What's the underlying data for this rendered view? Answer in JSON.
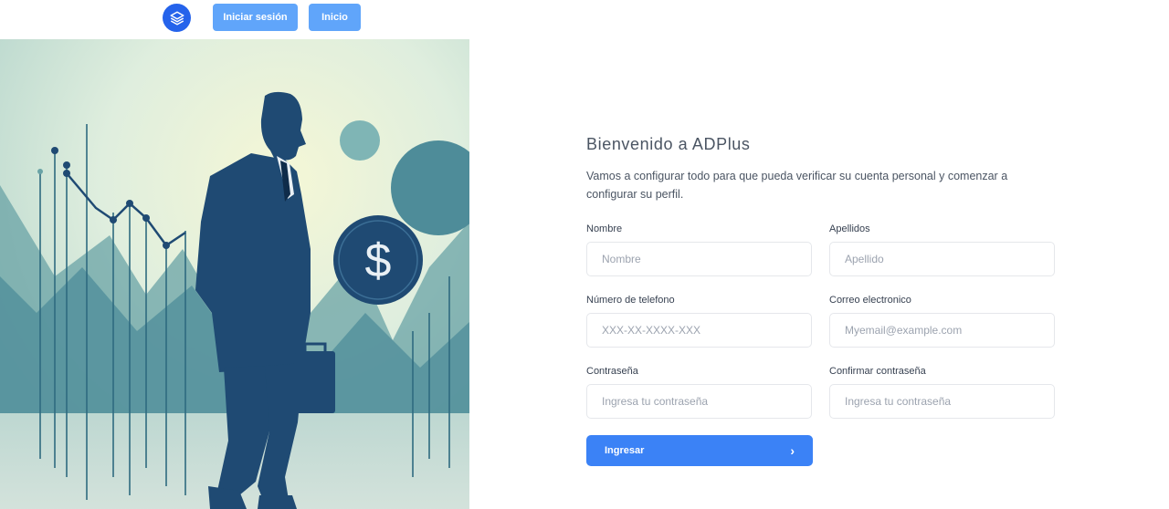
{
  "nav": {
    "logo_icon": "layers-icon",
    "login_label": "Iniciar sesión",
    "home_label": "Inicio"
  },
  "hero": {
    "image": "businessman-with-briefcase-and-dollar-coin-illustration",
    "dollar_symbol": "$"
  },
  "form": {
    "title": "Bienvenido a ADPlus",
    "subtitle": "Vamos a configurar todo para que pueda verificar su cuenta personal y comenzar a configurar su perfil.",
    "first_name": {
      "label": "Nombre",
      "placeholder": "Nombre"
    },
    "last_name": {
      "label": "Apellidos",
      "placeholder": "Apellido"
    },
    "phone": {
      "label": "Número de telefono",
      "placeholder": "XXX-XX-XXXX-XXX"
    },
    "email": {
      "label": "Correo electronico",
      "placeholder": "Myemail@example.com"
    },
    "password": {
      "label": "Contraseña",
      "placeholder": "Ingresa tu contraseña"
    },
    "confirm_password": {
      "label": "Confirmar contraseña",
      "placeholder": "Ingresa tu contraseña"
    },
    "submit_label": "Ingresar",
    "submit_icon": "chevron-right-icon"
  },
  "colors": {
    "primary": "#3b82f6",
    "nav_button": "#60a5fa",
    "logo": "#2563eb",
    "hero_teal": "#4e8c99",
    "hero_navy": "#1f4a73"
  }
}
